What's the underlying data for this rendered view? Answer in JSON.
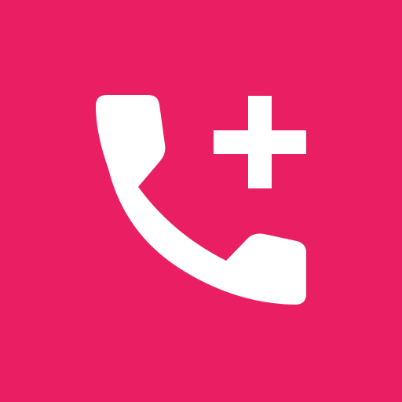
{
  "icon": {
    "name": "add-call-icon",
    "description_glyphs": [
      "phone-handset-icon",
      "plus-icon"
    ]
  },
  "colors": {
    "background": "#E91E63",
    "glyph": "#FFFFFF"
  }
}
